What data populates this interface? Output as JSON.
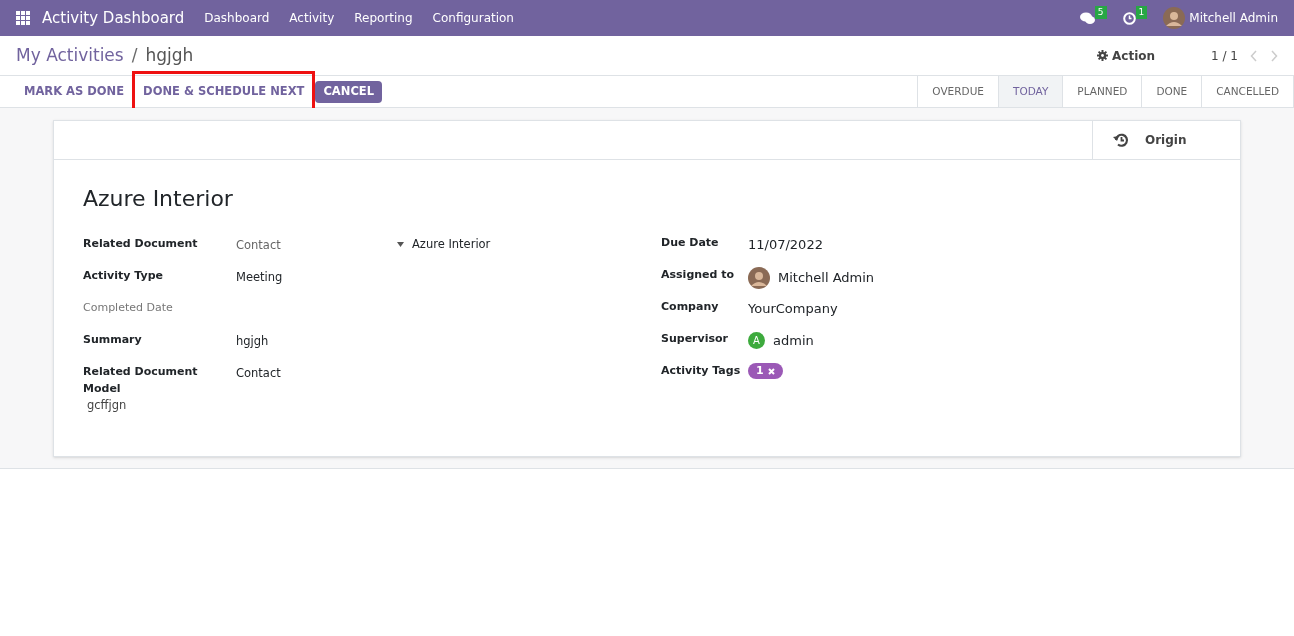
{
  "navbar": {
    "app_title": "Activity Dashboard",
    "menu": [
      "Dashboard",
      "Activity",
      "Reporting",
      "Configuration"
    ],
    "messages_count": "5",
    "activities_count": "1",
    "user": "Mitchell Admin"
  },
  "control_panel": {
    "separator": "/",
    "breadcrumb": [
      {
        "label": "My Activities",
        "link": true
      },
      {
        "label": "hgjgh",
        "link": false
      }
    ],
    "action": "Action",
    "pager": "1 / 1"
  },
  "buttons": [
    {
      "label": "MARK AS DONE",
      "primary": false,
      "highlighted": false
    },
    {
      "label": "DONE & SCHEDULE NEXT",
      "primary": false,
      "highlighted": true
    },
    {
      "label": "CANCEL",
      "primary": true,
      "highlighted": false
    }
  ],
  "stages": [
    {
      "label": "OVERDUE",
      "selected": false
    },
    {
      "label": "TODAY",
      "selected": true
    },
    {
      "label": "PLANNED",
      "selected": false
    },
    {
      "label": "DONE",
      "selected": false
    },
    {
      "label": "CANCELLED",
      "selected": false
    }
  ],
  "form": {
    "smart_button": "Origin",
    "title": "Azure Interior",
    "left_fields": [
      {
        "label": "Related Document",
        "value": "Contact",
        "muted_value": true,
        "muted_label": false,
        "record": "Azure Interior"
      },
      {
        "label": "Activity Type",
        "value": "Meeting",
        "muted_value": false,
        "muted_label": false
      },
      {
        "label": "Completed Date",
        "muted_label": true
      },
      {
        "label": "Summary",
        "value": "hgjgh",
        "muted_value": false,
        "muted_label": false
      },
      {
        "label": "Related Document Model",
        "value": "Contact",
        "muted_value": false,
        "muted_label": false
      }
    ],
    "note": "gcffjgn",
    "right_fields": [
      {
        "label": "Due Date",
        "kind": "text",
        "value": "11/07/2022"
      },
      {
        "label": "Assigned to",
        "kind": "user",
        "value": "Mitchell Admin"
      },
      {
        "label": "Company",
        "kind": "text",
        "value": "YourCompany"
      },
      {
        "label": "Supervisor",
        "kind": "letter",
        "initial": "A",
        "value": "admin",
        "color": "#3daa3d"
      },
      {
        "label": "Activity Tags",
        "kind": "tag",
        "value": "1",
        "color": "#9b59b6"
      }
    ]
  }
}
